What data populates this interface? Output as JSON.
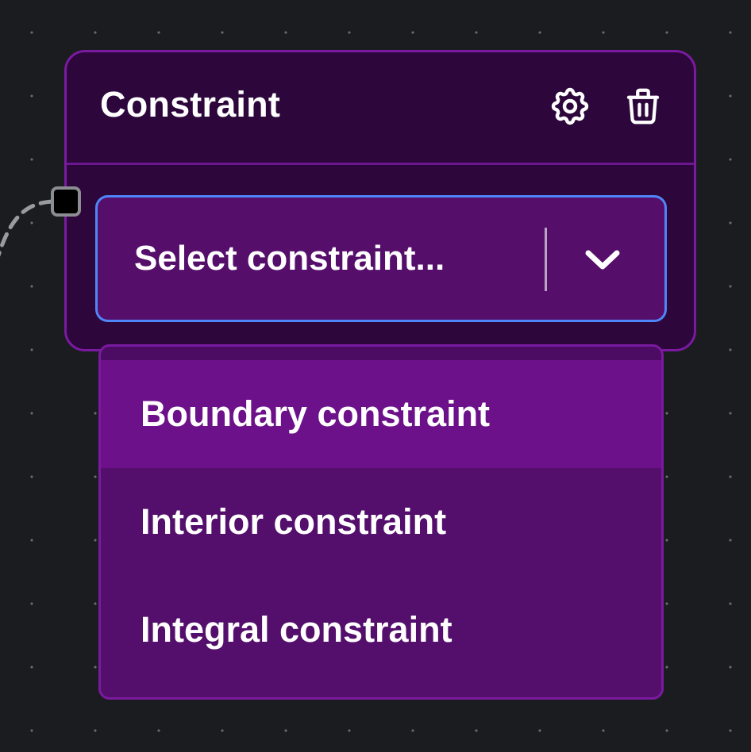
{
  "node": {
    "title": "Constraint",
    "actions": {
      "settings_icon": "gear-icon",
      "delete_icon": "trash-icon"
    }
  },
  "select": {
    "placeholder": "Select constraint...",
    "open": true
  },
  "menu": {
    "items": [
      {
        "label": "Boundary constraint",
        "highlighted": true
      },
      {
        "label": "Interior constraint",
        "highlighted": false
      },
      {
        "label": "Integral constraint",
        "highlighted": false
      }
    ]
  },
  "colors": {
    "canvas_bg": "#1b1c1f",
    "canvas_dot": "#6a6b70",
    "node_bg": "#2d063b",
    "node_border": "#7a1aa0",
    "select_bg": "#560e6b",
    "focus_ring": "#4f86f7",
    "menu_bg": "#540e6c",
    "menu_item_highlight": "#6c1189",
    "text": "#ffffff",
    "edge": "#9a9ba0"
  }
}
